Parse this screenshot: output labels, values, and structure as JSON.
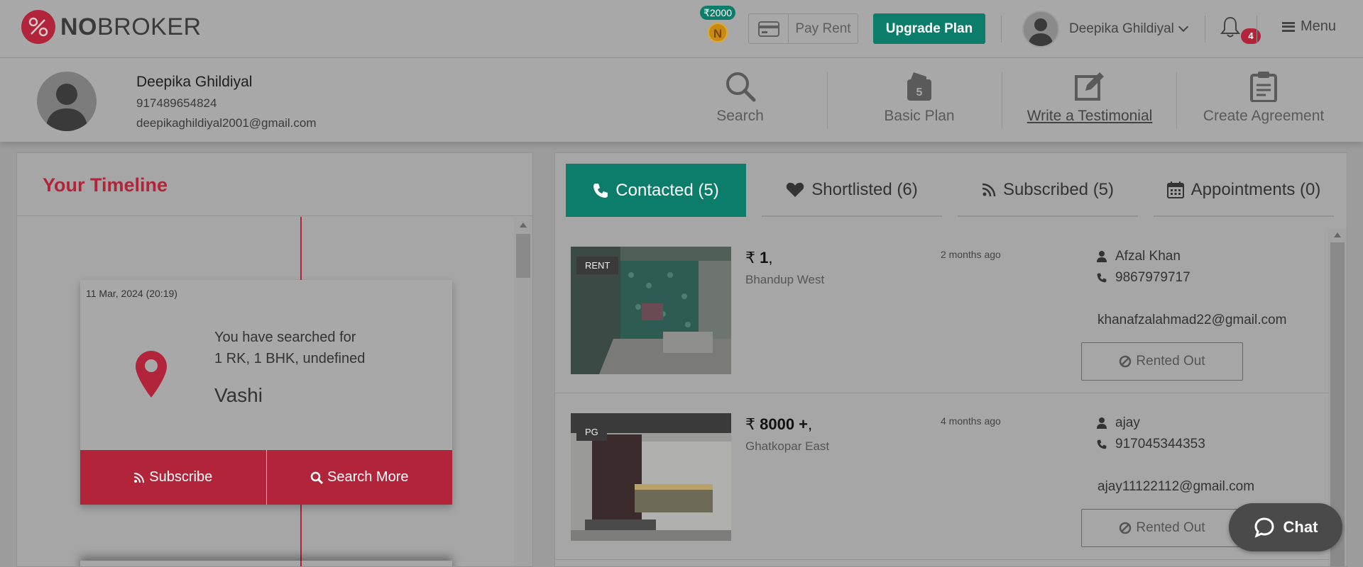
{
  "header": {
    "logo_text_bold": "NO",
    "logo_text": "BROKER",
    "coins": "₹2000",
    "coin_letter": "N",
    "pay_rent": "Pay Rent",
    "upgrade": "Upgrade Plan",
    "user_name": "Deepika Ghildiyal",
    "notifications": "4",
    "menu": "Menu"
  },
  "profile": {
    "name": "Deepika Ghildiyal",
    "phone": "917489654824",
    "email": "deepikaghildiyal2001@gmail.com"
  },
  "quick_actions": [
    {
      "label": "Search",
      "icon": "search-icon"
    },
    {
      "label": "Basic Plan",
      "icon": "wallet-icon",
      "badge": "5"
    },
    {
      "label": "Write a Testimonial",
      "icon": "edit-icon"
    },
    {
      "label": "Create Agreement",
      "icon": "clipboard-icon"
    }
  ],
  "timeline": {
    "title": "Your Timeline",
    "card": {
      "date": "11 Mar, 2024 (20:19)",
      "line1": "You have searched for",
      "line2": "1 RK, 1 BHK, undefined",
      "city": "Vashi",
      "subscribe": "Subscribe",
      "search_more": "Search More"
    }
  },
  "tabs": [
    {
      "label": "Contacted (5)",
      "icon": "phone-icon",
      "active": true
    },
    {
      "label": "Shortlisted (6)",
      "icon": "heart-icon",
      "active": false
    },
    {
      "label": "Subscribed (5)",
      "icon": "rss-icon",
      "active": false
    },
    {
      "label": "Appointments (0)",
      "icon": "calendar-icon",
      "active": false
    }
  ],
  "listings": [
    {
      "tag": "RENT",
      "price": "1",
      "locality": "Bhandup West",
      "time": "2 months ago",
      "owner": "Afzal Khan",
      "phone": "9867979717",
      "email": "khanafzalahmad22@gmail.com",
      "status": "Rented Out"
    },
    {
      "tag": "PG",
      "price": "8000 +",
      "locality": "Ghatkopar East",
      "time": "4 months ago",
      "owner": "ajay",
      "phone": "917045344353",
      "email": "ajay11122112@gmail.com",
      "status": "Rented Out"
    }
  ],
  "chat": "Chat",
  "colors": {
    "brand_red": "#b1243a",
    "brand_green": "#0c7c6b"
  }
}
